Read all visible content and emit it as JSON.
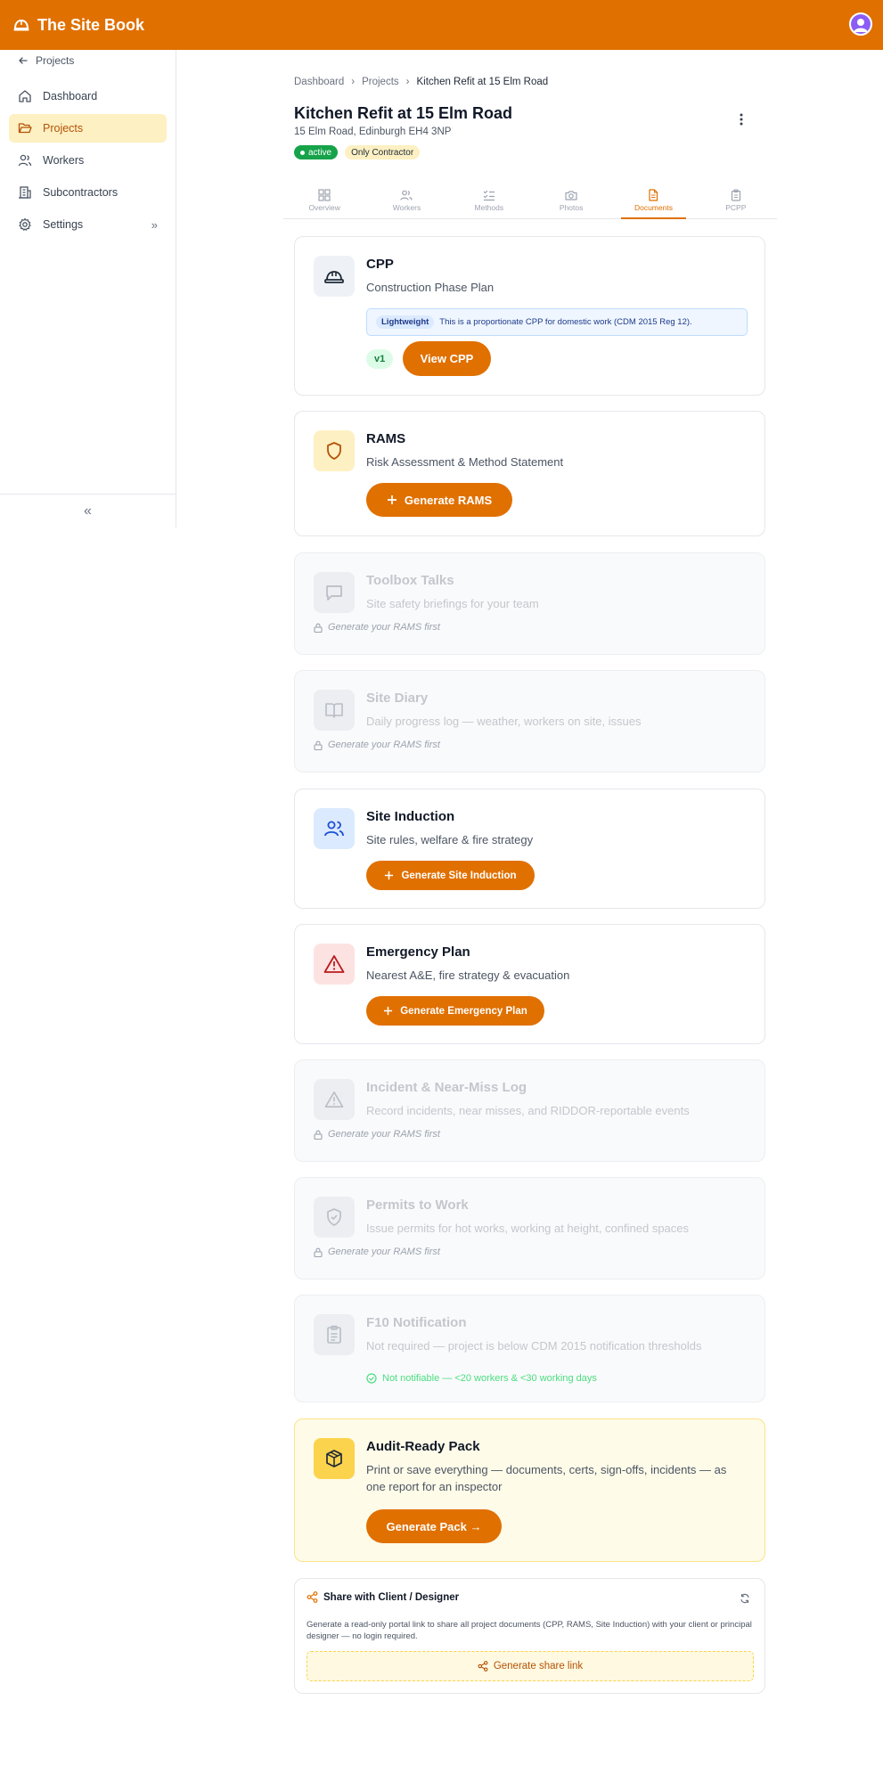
{
  "header": {
    "brand": "The Site Book"
  },
  "sidebar": {
    "back_label": "Projects",
    "items": [
      {
        "label": "Dashboard",
        "icon": "home-icon"
      },
      {
        "label": "Projects",
        "icon": "folder-icon",
        "active": true
      },
      {
        "label": "Workers",
        "icon": "users-icon"
      },
      {
        "label": "Subcontractors",
        "icon": "building-icon"
      },
      {
        "label": "Settings",
        "icon": "gear-icon"
      }
    ]
  },
  "breadcrumb": {
    "items": [
      "Dashboard",
      "Projects"
    ],
    "current": "Kitchen Refit at 15 Elm Road"
  },
  "project": {
    "title": "Kitchen Refit at 15 Elm Road",
    "address": "15 Elm Road, Edinburgh EH4 3NP",
    "status": "active",
    "contractor_badge": "Only Contractor"
  },
  "tabs": [
    {
      "label": "Overview"
    },
    {
      "label": "Workers"
    },
    {
      "label": "Methods"
    },
    {
      "label": "Photos"
    },
    {
      "label": "Documents",
      "active": true
    },
    {
      "label": "PCPP"
    }
  ],
  "cards": {
    "cpp": {
      "title": "CPP",
      "subtitle": "Construction Phase Plan",
      "info_pill": "Lightweight",
      "info_text": "This is a proportionate CPP for domestic work (CDM 2015 Reg 12).",
      "version": "v1",
      "button": "View CPP"
    },
    "rams": {
      "title": "RAMS",
      "subtitle": "Risk Assessment & Method Statement",
      "button": "Generate RAMS"
    },
    "toolbox": {
      "title": "Toolbox Talks",
      "subtitle": "Site safety briefings for your team",
      "lock_note": "Generate your RAMS first"
    },
    "diary": {
      "title": "Site Diary",
      "subtitle": "Daily progress log — weather, workers on site, issues",
      "lock_note": "Generate your RAMS first"
    },
    "induction": {
      "title": "Site Induction",
      "subtitle": "Site rules, welfare & fire strategy",
      "button": "Generate Site Induction"
    },
    "emergency": {
      "title": "Emergency Plan",
      "subtitle": "Nearest A&E, fire strategy & evacuation",
      "button": "Generate Emergency Plan"
    },
    "incident": {
      "title": "Incident & Near-Miss Log",
      "subtitle": "Record incidents, near misses, and RIDDOR-reportable events",
      "lock_note": "Generate your RAMS first"
    },
    "permits": {
      "title": "Permits to Work",
      "subtitle": "Issue permits for hot works, working at height, confined spaces",
      "lock_note": "Generate your RAMS first"
    },
    "f10": {
      "title": "F10 Notification",
      "subtitle": "Not required — project is below CDM 2015 notification thresholds",
      "note": "Not notifiable — <20 workers & <30 working days"
    },
    "audit": {
      "title": "Audit-Ready Pack",
      "subtitle": "Print or save everything — documents, certs, sign-offs, incidents — as one report for an inspector",
      "button": "Generate Pack →"
    }
  },
  "share": {
    "title": "Share with Client / Designer",
    "description": "Generate a read-only portal link to share all project documents (CPP, RAMS, Site Induction) with your client or principal designer — no login required.",
    "button": "Generate share link"
  },
  "colors": {
    "accent": "#e07000",
    "active_green": "#16a34a",
    "highlight": "#fdf0c2"
  }
}
